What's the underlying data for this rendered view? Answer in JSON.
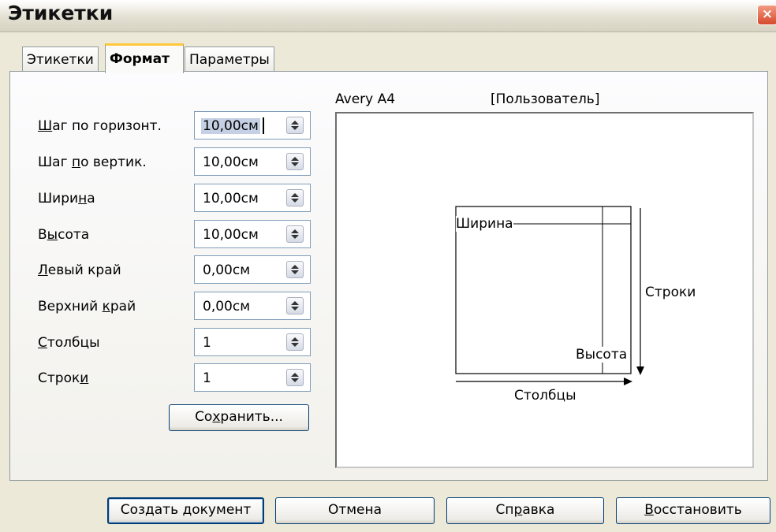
{
  "window": {
    "title": "Этикетки",
    "close_glyph": "×"
  },
  "tabs": [
    {
      "label": "Этикетки",
      "active": false
    },
    {
      "label": "Формат",
      "active": true
    },
    {
      "label": "Параметры",
      "active": false
    }
  ],
  "fields": [
    {
      "name": "hstep",
      "label_pre": "",
      "label_ul": "Ш",
      "label_post": "аг по горизонт.",
      "value": "10,00см",
      "selected": true
    },
    {
      "name": "vstep",
      "label_pre": "Шаг ",
      "label_ul": "п",
      "label_post": "о вертик.",
      "value": "10,00см"
    },
    {
      "name": "width",
      "label_pre": "Шири",
      "label_ul": "н",
      "label_post": "а",
      "value": "10,00см"
    },
    {
      "name": "height",
      "label_pre": "В",
      "label_ul": "ы",
      "label_post": "сота",
      "value": "10,00см"
    },
    {
      "name": "left-margin",
      "label_pre": "",
      "label_ul": "Л",
      "label_post": "евый край",
      "value": "0,00см"
    },
    {
      "name": "top-margin",
      "label_pre": "Верхний ",
      "label_ul": "к",
      "label_post": "рай",
      "value": "0,00см"
    },
    {
      "name": "columns",
      "label_pre": "",
      "label_ul": "С",
      "label_post": "толбцы",
      "value": "1"
    },
    {
      "name": "rows",
      "label_pre": "Строк",
      "label_ul": "и",
      "label_post": "",
      "value": "1"
    }
  ],
  "save_button": {
    "pre": "Со",
    "ul": "х",
    "post": "ранить..."
  },
  "preview": {
    "brand": "Avery A4",
    "type": "[Пользователь]",
    "width_label": "Ширина",
    "height_label": "Высота",
    "rows_label": "Строки",
    "columns_label": "Столбцы"
  },
  "buttons": {
    "create": "Создать документ",
    "cancel": "Отмена",
    "help_pre": "Сп",
    "help_ul": "р",
    "help_post": "авка",
    "reset_ul": "В",
    "reset_post": "осстановить"
  }
}
